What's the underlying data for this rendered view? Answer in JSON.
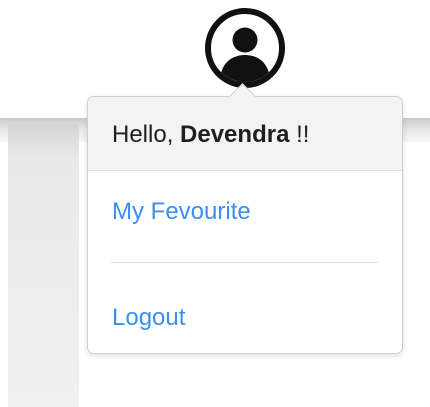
{
  "user": {
    "greeting_prefix": "Hello,",
    "name": "Devendra",
    "greeting_suffix": "!!"
  },
  "menu": {
    "items": [
      {
        "label": "My Fevourite"
      },
      {
        "label": "Logout"
      }
    ]
  },
  "colors": {
    "link": "#3d8ef0",
    "header_bg": "#f3f3f3",
    "avatar_icon": "#111111"
  },
  "icons": {
    "avatar": "user-avatar-icon"
  }
}
